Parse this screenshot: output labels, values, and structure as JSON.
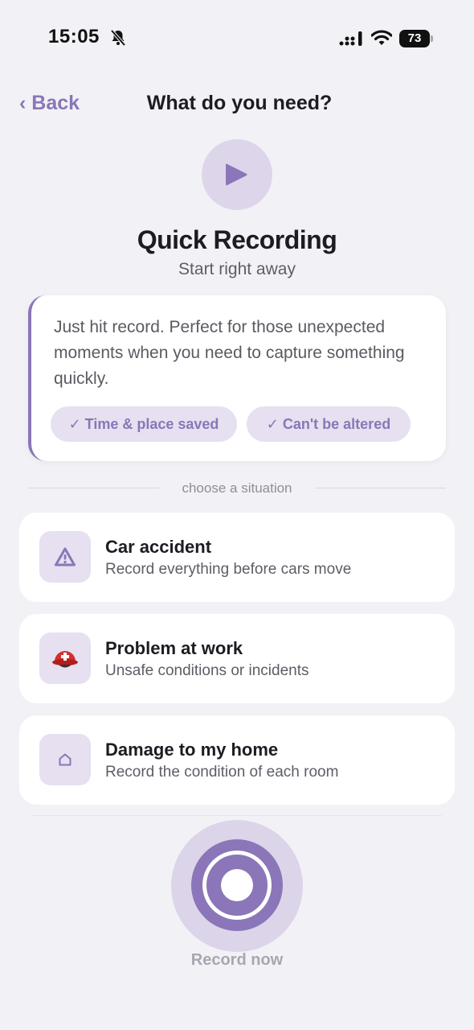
{
  "status_bar": {
    "time": "15:05",
    "battery": "73"
  },
  "nav": {
    "back_label": "‹ Back",
    "title": "What do you need?"
  },
  "hero": {
    "title": "Quick Recording",
    "subtitle": "Start right away"
  },
  "description": {
    "text": "Just hit record. Perfect for those unexpected moments when you need to capture something quickly.",
    "chips": [
      "✓ Time & place saved",
      "✓ Can't be altered"
    ]
  },
  "divider_label": "choose a situation",
  "situations": [
    {
      "title": "Car accident",
      "subtitle": "Record everything before cars move",
      "icon": "warning-icon"
    },
    {
      "title": "Problem at work",
      "subtitle": "Unsafe conditions or incidents",
      "icon": "rescue-helmet-icon"
    },
    {
      "title": "Damage to my home",
      "subtitle": "Record the condition of each room",
      "icon": "house-icon"
    }
  ],
  "record": {
    "label": "Record now"
  },
  "colors": {
    "accent": "#8a76b8",
    "accent_soft": "#e6e0f0",
    "background": "#f2f2f6"
  }
}
